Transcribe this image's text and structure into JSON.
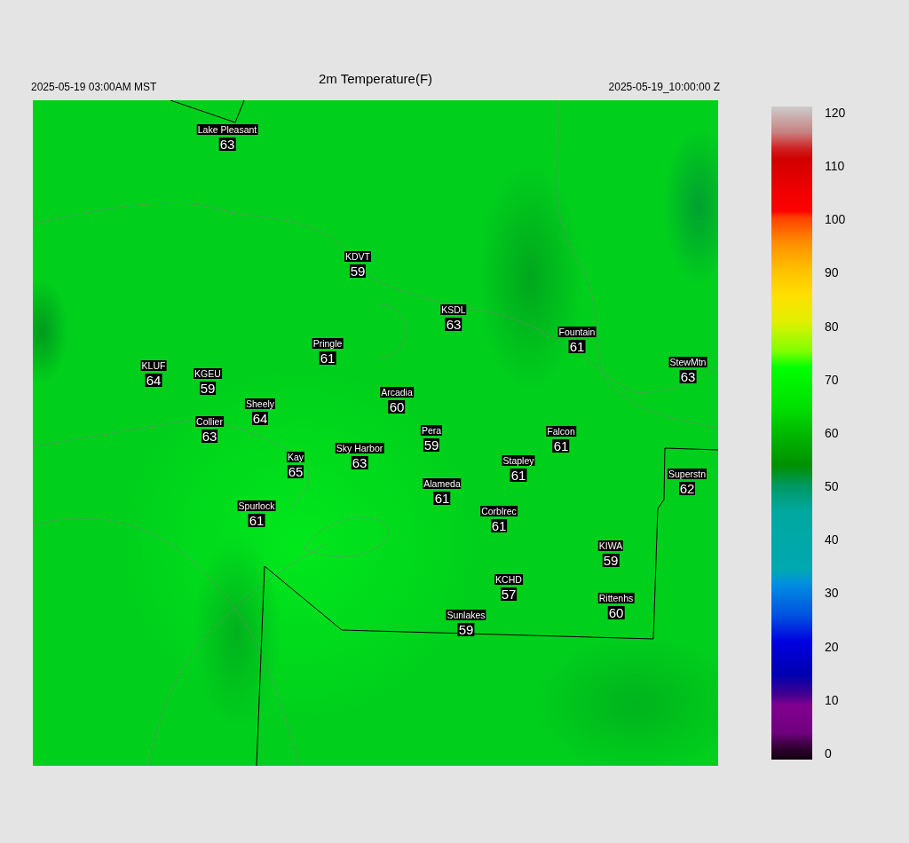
{
  "header": {
    "local_time": "2025-05-19 03:00AM MST",
    "title": "2m Temperature(F)",
    "valid_time": "2025-05-19_10:00:00 Z"
  },
  "stations": [
    {
      "name": "Lake Pleasant",
      "value": "63"
    },
    {
      "name": "KDVT",
      "value": "59"
    },
    {
      "name": "KSDL",
      "value": "63"
    },
    {
      "name": "Pringle",
      "value": "61"
    },
    {
      "name": "Fountain",
      "value": "61"
    },
    {
      "name": "KLUF",
      "value": "64"
    },
    {
      "name": "KGEU",
      "value": "59"
    },
    {
      "name": "StewMtn",
      "value": "63"
    },
    {
      "name": "Sheely",
      "value": "64"
    },
    {
      "name": "Arcadia",
      "value": "60"
    },
    {
      "name": "Collier",
      "value": "63"
    },
    {
      "name": "Pera",
      "value": "59"
    },
    {
      "name": "Falcon",
      "value": "61"
    },
    {
      "name": "Kay",
      "value": "65"
    },
    {
      "name": "Sky Harbor",
      "value": "63"
    },
    {
      "name": "Stapley",
      "value": "61"
    },
    {
      "name": "Superstn",
      "value": "62"
    },
    {
      "name": "Alameda",
      "value": "61"
    },
    {
      "name": "Spurlock",
      "value": "61"
    },
    {
      "name": "Corblrec",
      "value": "61"
    },
    {
      "name": "KIWA",
      "value": "59"
    },
    {
      "name": "KCHD",
      "value": "57"
    },
    {
      "name": "Rittenhs",
      "value": "60"
    },
    {
      "name": "Sunlakes",
      "value": "59"
    }
  ],
  "colorbar": {
    "ticks": [
      "120",
      "110",
      "100",
      "90",
      "80",
      "70",
      "60",
      "50",
      "40",
      "30",
      "20",
      "10",
      "0"
    ]
  }
}
